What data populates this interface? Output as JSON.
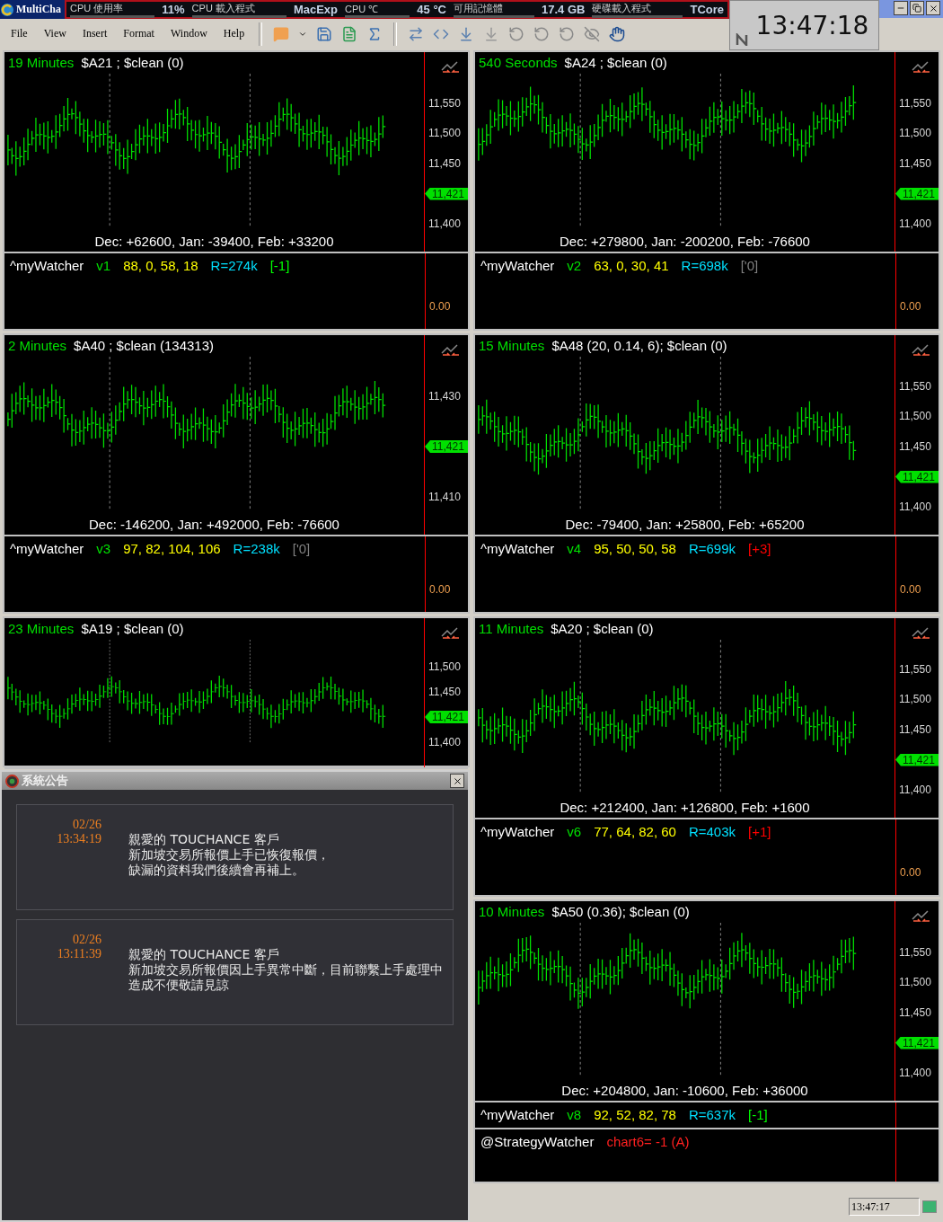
{
  "app_title": "MultiCha",
  "monitor": [
    {
      "text": "CPU 使用率",
      "kind": "label"
    },
    {
      "text": "11%",
      "kind": "value"
    },
    {
      "text": "CPU 載入程式",
      "kind": "label"
    },
    {
      "text": "MacExp",
      "kind": "value"
    },
    {
      "text": "CPU ℃",
      "kind": "label"
    },
    {
      "text": "45 °C",
      "kind": "value"
    },
    {
      "text": "可用記憶體",
      "kind": "label"
    },
    {
      "text": "17.4 GB",
      "kind": "value"
    },
    {
      "text": "硬碟載入程式",
      "kind": "label"
    },
    {
      "text": "TCore",
      "kind": "value"
    }
  ],
  "menu": [
    "File",
    "View",
    "Insert",
    "Format",
    "Window",
    "Help"
  ],
  "clock": "13:47:18",
  "left_charts": [
    {
      "interval": "19 Minutes",
      "title": "$A21 ; $clean (0)",
      "axis": [
        {
          "text": "11,550",
          "kind": "tick"
        },
        {
          "text": "11,500",
          "kind": "tick"
        },
        {
          "text": "11,450",
          "kind": "tick"
        },
        {
          "text": "11,421",
          "kind": "last"
        },
        {
          "text": "11,400",
          "kind": "tick"
        }
      ],
      "footer": "Dec: +62600,  Jan: -39400,  Feb: +33200",
      "watcher": {
        "name": "^myWatcher",
        "version": "v1",
        "values": "88, 0, 58, 18",
        "r": "R=274k",
        "signal": "[-1]",
        "color": "#00ff00"
      },
      "indicator_tick": "0.00"
    },
    {
      "interval": "2 Minutes",
      "title": "$A40 ; $clean (134313)",
      "axis": [
        {
          "text": "11,430",
          "kind": "tick"
        },
        {
          "text": "11,421",
          "kind": "last"
        },
        {
          "text": "11,410",
          "kind": "tick"
        }
      ],
      "footer": "Dec: -146200,  Jan: +492000,  Feb: -76600",
      "watcher": {
        "name": "^myWatcher",
        "version": "v3",
        "values": "97, 82, 104, 106",
        "r": "R=238k",
        "signal": "['0]",
        "color": "#808080"
      },
      "indicator_tick": "0.00"
    },
    {
      "interval": "23 Minutes",
      "title": "$A19 ; $clean (0)",
      "axis": [
        {
          "text": "11,500",
          "kind": "tick"
        },
        {
          "text": "11,450",
          "kind": "tick"
        },
        {
          "text": "11,421",
          "kind": "last"
        },
        {
          "text": "11,400",
          "kind": "tick"
        }
      ]
    }
  ],
  "notice": {
    "title": "系統公告",
    "messages": [
      {
        "date": "02/26",
        "time": "13:34:19",
        "lines": [
          "親愛的 TOUCHANCE 客戶",
          "新加坡交易所報價上手已恢復報價，",
          "缺漏的資料我們後續會再補上。"
        ]
      },
      {
        "date": "02/26",
        "time": "13:11:39",
        "lines": [
          "親愛的 TOUCHANCE 客戶",
          "新加坡交易所報價因上手異常中斷，目前聯繫上手處理中",
          "造成不便敬請見諒"
        ]
      }
    ]
  },
  "right_charts": [
    {
      "interval": "540 Seconds",
      "title": "$A24 ; $clean (0)",
      "axis": [
        {
          "text": "11,550",
          "kind": "tick"
        },
        {
          "text": "11,500",
          "kind": "tick"
        },
        {
          "text": "11,450",
          "kind": "tick"
        },
        {
          "text": "11,421",
          "kind": "last"
        },
        {
          "text": "11,400",
          "kind": "tick"
        }
      ],
      "footer": "Dec: +279800,  Jan: -200200,  Feb: -76600",
      "watcher": {
        "name": "^myWatcher",
        "version": "v2",
        "values": "63, 0, 30, 41",
        "r": "R=698k",
        "signal": "['0]",
        "color": "#808080"
      },
      "indicator_tick": "0.00"
    },
    {
      "interval": "15 Minutes",
      "title": "$A48 (20,  0.14,  6); $clean (0)",
      "axis": [
        {
          "text": "11,550",
          "kind": "tick"
        },
        {
          "text": "11,500",
          "kind": "tick"
        },
        {
          "text": "11,450",
          "kind": "tick"
        },
        {
          "text": "11,421",
          "kind": "last"
        },
        {
          "text": "11,400",
          "kind": "tick"
        }
      ],
      "footer": "Dec: -79400,  Jan: +25800,  Feb: +65200",
      "watcher": {
        "name": "^myWatcher",
        "version": "v4",
        "values": "95, 50, 50, 58",
        "r": "R=699k",
        "signal": "[+3]",
        "color": "#ff0000"
      },
      "indicator_tick": "0.00"
    },
    {
      "interval": "11 Minutes",
      "title": "$A20 ; $clean (0)",
      "axis": [
        {
          "text": "11,550",
          "kind": "tick"
        },
        {
          "text": "11,500",
          "kind": "tick"
        },
        {
          "text": "11,450",
          "kind": "tick"
        },
        {
          "text": "11,421",
          "kind": "last"
        },
        {
          "text": "11,400",
          "kind": "tick"
        }
      ],
      "footer": "Dec: +212400,  Jan: +126800,  Feb: +1600",
      "watcher": {
        "name": "^myWatcher",
        "version": "v6",
        "values": "77, 64, 82, 60",
        "r": "R=403k",
        "signal": "[+1]",
        "color": "#ff0000"
      },
      "indicator_tick": "0.00"
    },
    {
      "interval": "10 Minutes",
      "title": "$A50 (0.36); $clean (0)",
      "axis": [
        {
          "text": "11,550",
          "kind": "tick"
        },
        {
          "text": "11,500",
          "kind": "tick"
        },
        {
          "text": "11,450",
          "kind": "tick"
        },
        {
          "text": "11,421",
          "kind": "last"
        },
        {
          "text": "11,400",
          "kind": "tick"
        }
      ],
      "footer": "Dec: +204800,  Jan: -10600,  Feb: +36000",
      "watcher": {
        "name": "^myWatcher",
        "version": "v8",
        "values": "92, 52, 82, 78",
        "r": "R=637k",
        "signal": "[-1]",
        "color": "#00ff00"
      },
      "strategy": {
        "name": "@StrategyWatcher",
        "text": "chart6= -1 (A)"
      }
    }
  ],
  "status_bar": {
    "time": "13:47:17"
  }
}
